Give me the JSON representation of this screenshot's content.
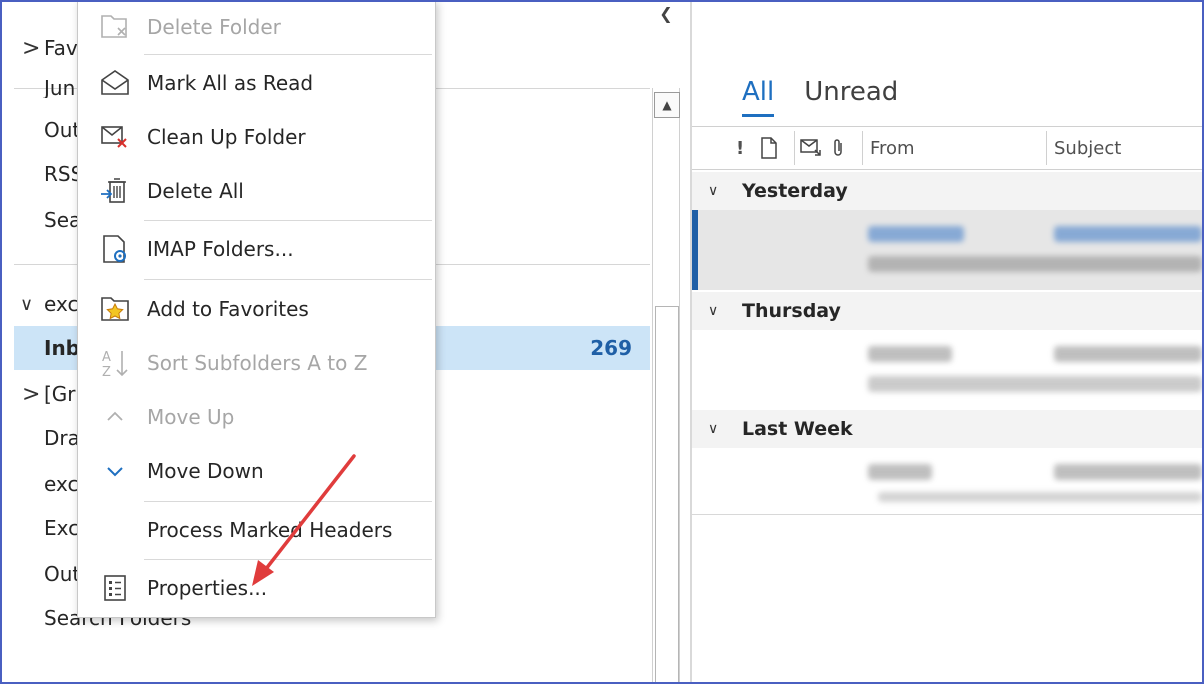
{
  "folder_pane": {
    "rows": [
      {
        "label": "Fav",
        "chev": ">"
      },
      {
        "label": "Jun"
      },
      {
        "label": "Out"
      },
      {
        "label": "RSS"
      },
      {
        "label": "Sea"
      },
      {
        "label": "exc",
        "chev": "∨"
      },
      {
        "label": "Inb",
        "count": "269"
      },
      {
        "label": "[Gr",
        "chev": ">"
      },
      {
        "label": "Dra"
      },
      {
        "label": "exc"
      },
      {
        "label": "Exc"
      },
      {
        "label": "Out"
      },
      {
        "label": "Search Folders"
      }
    ]
  },
  "message_list": {
    "tabs": [
      "All",
      "Unread"
    ],
    "columns": {
      "importance": "!",
      "from": "From",
      "subject": "Subject"
    },
    "groups": [
      "Yesterday",
      "Thursday",
      "Last Week"
    ]
  },
  "context_menu": {
    "items": [
      {
        "label": "Delete Folder",
        "icon": "delete-folder-icon",
        "enabled": false
      },
      {
        "label": "Mark All as Read",
        "icon": "envelope-open-icon",
        "enabled": true
      },
      {
        "label": "Clean Up Folder",
        "icon": "clean-up-folder-icon",
        "enabled": true
      },
      {
        "label": "Delete All",
        "icon": "delete-all-icon",
        "enabled": true
      },
      {
        "label": "IMAP Folders...",
        "icon": "imap-folders-icon",
        "enabled": true
      },
      {
        "label": "Add to Favorites",
        "icon": "favorites-star-icon",
        "enabled": true
      },
      {
        "label": "Sort Subfolders A to Z",
        "icon": "sort-az-icon",
        "enabled": false
      },
      {
        "label": "Move Up",
        "icon": "chevron-up-icon",
        "enabled": false
      },
      {
        "label": "Move Down",
        "icon": "chevron-down-icon",
        "enabled": true
      },
      {
        "label": "Process Marked Headers",
        "icon": "",
        "enabled": true
      },
      {
        "label": "Properties...",
        "icon": "properties-icon",
        "enabled": true
      }
    ]
  },
  "colors": {
    "accent": "#1e6fc0",
    "selection": "#cce4f7",
    "count": "#1f5fa6",
    "annotation_arrow": "#e03c3c"
  }
}
